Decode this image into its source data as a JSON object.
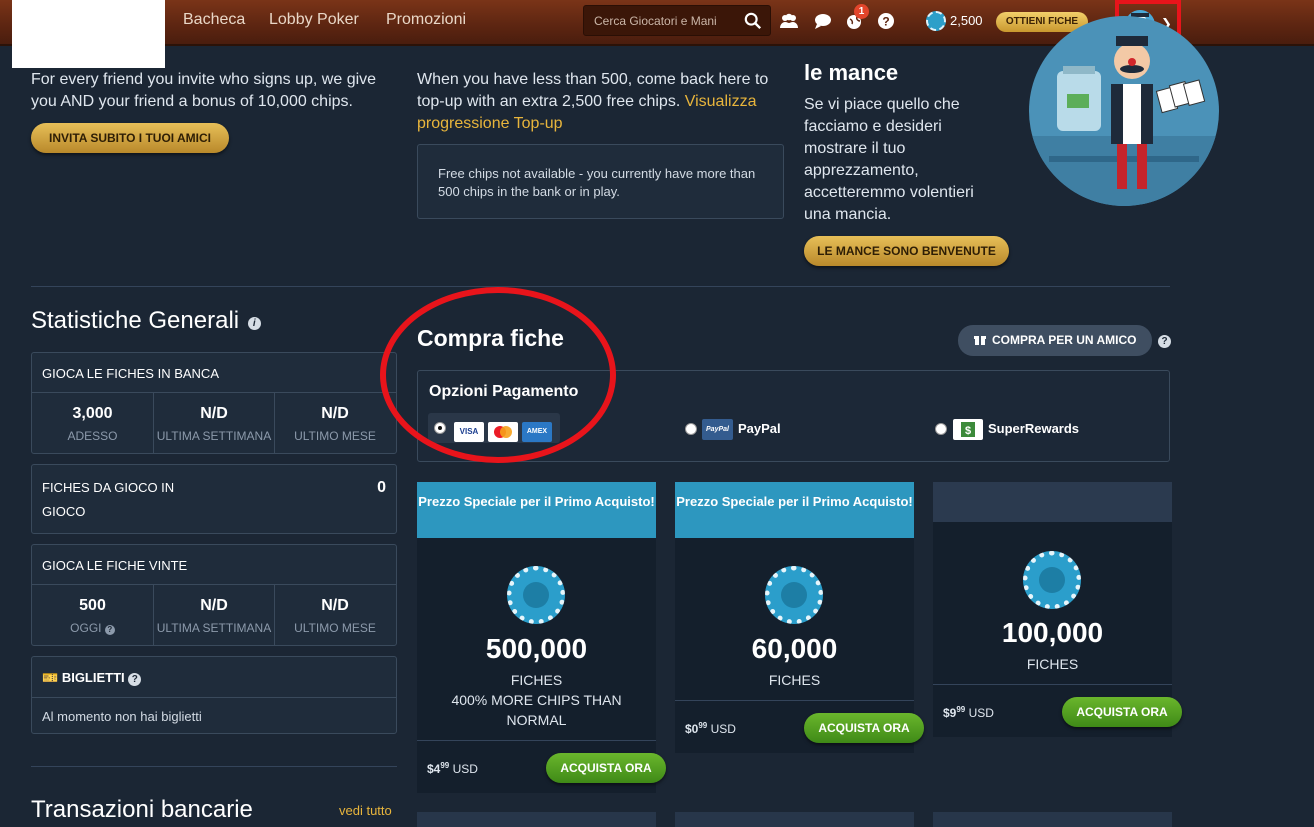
{
  "nav": {
    "links": [
      "Bacheca",
      "Lobby Poker",
      "Promozioni"
    ],
    "search_placeholder": "Cerca Giocatori e Mani",
    "notification_count": "1",
    "chip_balance": "2,500",
    "get_chips_label": "OTTIENI FICHE"
  },
  "invite": {
    "text": "For every friend you invite who signs up, we give you AND your friend a bonus of 10,000 chips.",
    "button": "INVITA SUBITO I TUOI AMICI"
  },
  "topup": {
    "text": "When you have less than 500, come back here to top-up with an extra 2,500 free chips.",
    "link": "Visualizza progressione Top-up",
    "notice": "Free chips not available - you currently have more than 500 chips in the bank or in play."
  },
  "tips": {
    "title": "le mance",
    "text": "Se vi piace quello che facciamo e desideri mostrare il tuo apprezzamento, accetteremmo volentieri una mancia.",
    "button": "LE MANCE SONO BENVENUTE"
  },
  "stats": {
    "title": "Statistiche Generali",
    "bank": {
      "header": "GIOCA LE FICHES IN BANCA",
      "cells": [
        {
          "value": "3,000",
          "label": "ADESSO"
        },
        {
          "value": "N/D",
          "label": "ULTIMA SETTIMANA"
        },
        {
          "value": "N/D",
          "label": "ULTIMO MESE"
        }
      ]
    },
    "in_play": {
      "line1": "FICHES DA GIOCO IN",
      "line2": "GIOCO",
      "value": "0"
    },
    "won": {
      "header": "GIOCA LE FICHE VINTE",
      "cells": [
        {
          "value": "500",
          "label": "OGGI"
        },
        {
          "value": "N/D",
          "label": "ULTIMA SETTIMANA"
        },
        {
          "value": "N/D",
          "label": "ULTIMO MESE"
        }
      ]
    },
    "tickets": {
      "header": "BIGLIETTI",
      "text": "Al momento non hai biglietti"
    }
  },
  "transactions": {
    "title": "Transazioni bancarie",
    "link": "vedi tutto"
  },
  "buy": {
    "title": "Compra fiche",
    "friend_button": "COMPRA PER UN AMICO",
    "payment_title": "Opzioni Pagamento",
    "cards": [
      "VISA",
      "MC",
      "AMEX"
    ],
    "paypal_logo": "PayPal",
    "paypal": "PayPal",
    "superrewards": "SuperRewards",
    "packages": [
      {
        "header": "Prezzo Speciale per il Primo Acquisto!",
        "amount": "500,000",
        "unit": "FICHES",
        "extra": "400% MORE CHIPS THAN NORMAL",
        "price_main": "$4",
        "price_cents": "99",
        "currency": "USD",
        "button": "ACQUISTA ORA"
      },
      {
        "header": "Prezzo Speciale per il Primo Acquisto!",
        "amount": "60,000",
        "unit": "FICHES",
        "price_main": "$0",
        "price_cents": "99",
        "currency": "USD",
        "button": "ACQUISTA ORA"
      },
      {
        "amount": "100,000",
        "unit": "FICHES",
        "price_main": "$9",
        "price_cents": "99",
        "currency": "USD",
        "button": "ACQUISTA ORA"
      }
    ]
  },
  "colors": {
    "accent_gold": "#e7bf58",
    "buy_green": "#4f9f20",
    "header_blue": "#2d97bf",
    "highlight_red": "#e8141b"
  }
}
